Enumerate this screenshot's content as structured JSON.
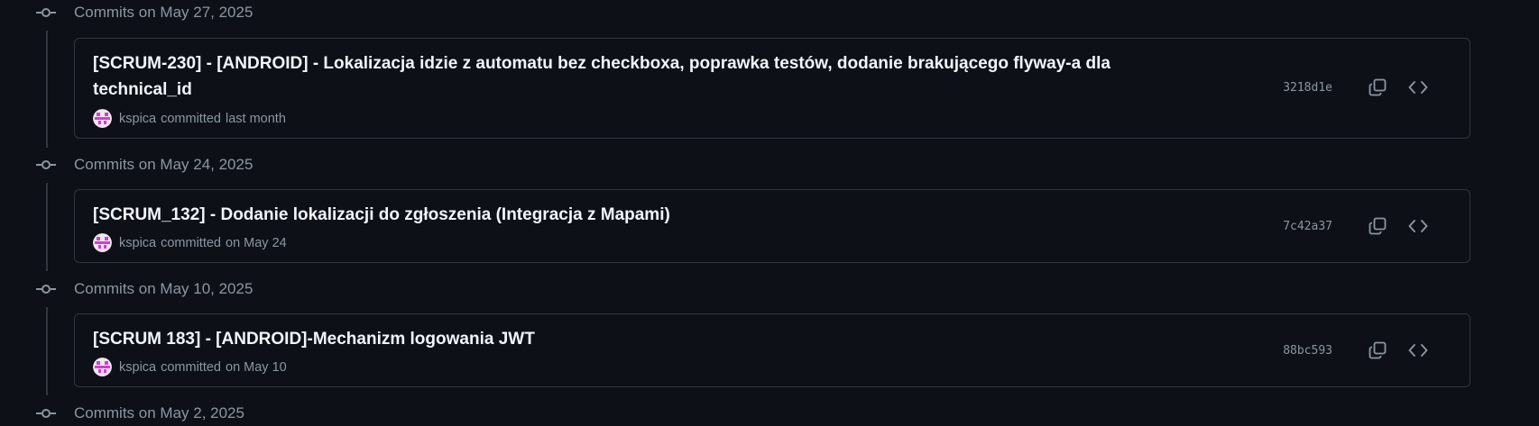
{
  "groups": [
    {
      "header": "Commits on May 27, 2025",
      "commits": [
        {
          "title": "[SCRUM-230] - [ANDROID] - Lokalizacja idzie z automatu bez checkboxa, poprawka testów, dodanie brakującego flyway-a dla technical_id",
          "author": "kspica",
          "action": "committed",
          "when": "last month",
          "sha": "3218d1e"
        }
      ]
    },
    {
      "header": "Commits on May 24, 2025",
      "commits": [
        {
          "title": "[SCRUM_132] - Dodanie lokalizacji do zgłoszenia (Integracja z Mapami)",
          "author": "kspica",
          "action": "committed",
          "when": "on May 24",
          "sha": "7c42a37"
        }
      ]
    },
    {
      "header": "Commits on May 10, 2025",
      "commits": [
        {
          "title": "[SCRUM 183] - [ANDROID]-Mechanizm logowania JWT",
          "author": "kspica",
          "action": "committed",
          "when": "on May 10",
          "sha": "88bc593"
        }
      ]
    },
    {
      "header": "Commits on May 2, 2025"
    }
  ],
  "icons": {
    "commit": "git-commit-icon",
    "copy": "copy-icon",
    "browse": "code-icon"
  },
  "colors": {
    "background": "#0d1117",
    "border": "#30363d",
    "muted_text": "#8d96a0",
    "title_text": "#f0f6fc",
    "avatar_accent": "#d63bd6"
  }
}
